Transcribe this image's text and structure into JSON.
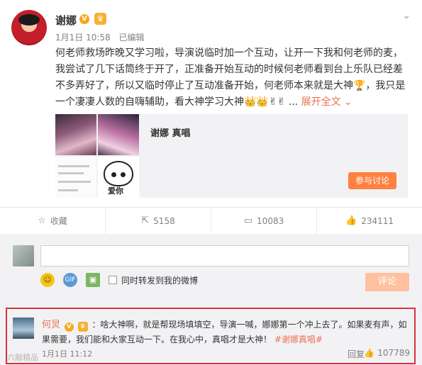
{
  "post": {
    "author": "谢娜",
    "v_badge": "V",
    "crown_icon": "crown-badge-icon",
    "meta": {
      "time": "1月1日 10:58",
      "edited": "已编辑"
    },
    "text": "何老师救场昨晚又学习啦，导演说临时加一个互动，让开一下我和何老师的麦，我尝试了几下话筒终于开了，正准备开始互动的时候何老师看到台上乐队已经差不多弄好了，所以又临时停止了互动准备开始，何老师本来就是大神🏆，我只是一个凄凄人数的自嗨辅助，看大神学习大神👑👑✌✌ ...",
    "expand_label": "展开全文 ⌄",
    "card": {
      "title": "谢娜 真唱",
      "join_label": "参与讨论",
      "sticker_text": "爱你"
    }
  },
  "actions": [
    {
      "icon": "star-icon",
      "label": "收藏"
    },
    {
      "icon": "share-icon",
      "label": "5158"
    },
    {
      "icon": "comment-icon",
      "label": "10083"
    },
    {
      "icon": "thumbs-up-icon",
      "label": "234111"
    }
  ],
  "composer": {
    "placeholder": "",
    "repost_label": "同时转发到我的微博",
    "submit_label": "评论"
  },
  "comment": {
    "name": "何炅",
    "v_badge": "V",
    "text": "：啥大神啊，就是帮现场填填空，导演一喊，娜娜第一个冲上去了。如果麦有声，如果需要，我们能和大家互动一下。在我心中，真唱才是大神！",
    "hashtag": "#谢娜真唱#",
    "time": "1月1日 11:12",
    "reply_label": "回复",
    "likes": "107789"
  },
  "watermark": "六献精品"
}
